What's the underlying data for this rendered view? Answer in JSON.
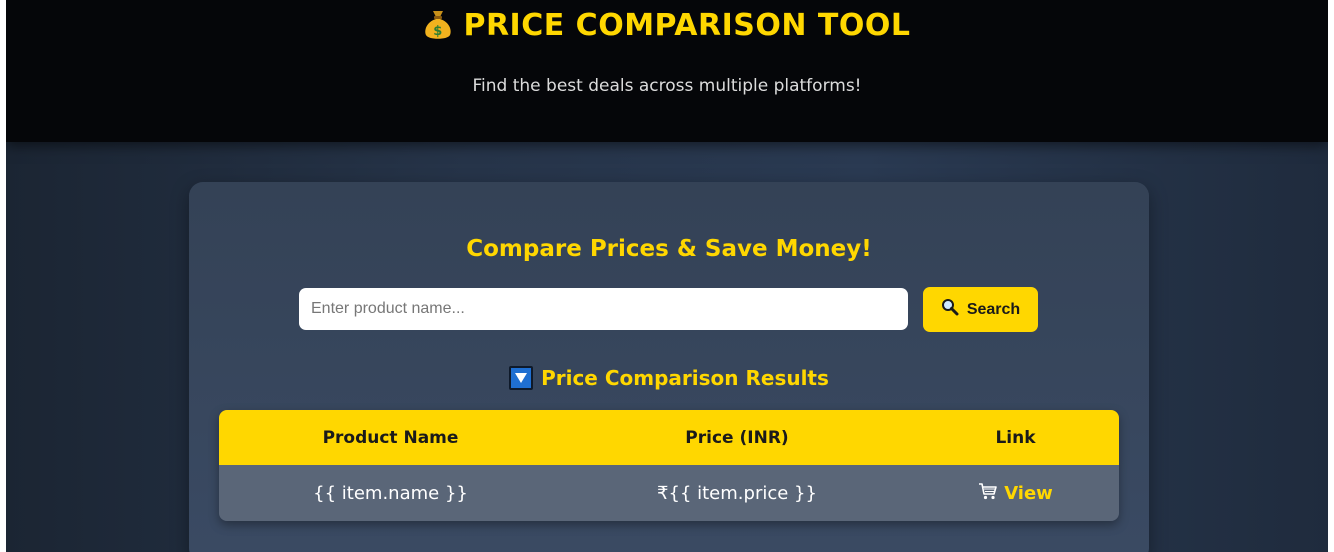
{
  "header": {
    "title": "PRICE COMPARISON TOOL",
    "title_icon": "money-bag-icon",
    "subtitle": "Find the best deals across multiple platforms!"
  },
  "main": {
    "heading": "Compare Prices & Save Money!",
    "search": {
      "placeholder": "Enter product name...",
      "value": "",
      "button_label": "Search",
      "button_icon": "magnifier-icon"
    },
    "results": {
      "heading": "Price Comparison Results",
      "heading_icon": "down-triangle-icon",
      "columns": [
        "Product Name",
        "Price (INR)",
        "Link"
      ],
      "rows": [
        {
          "name": "{{ item.name }}",
          "price": "₹{{ item.price }}",
          "link_label": "View",
          "link_icon": "cart-icon"
        }
      ]
    }
  },
  "colors": {
    "accent": "#ffd700",
    "header_bg": "#050609",
    "card_bg": "#344256",
    "row_bg": "#5a6678"
  }
}
